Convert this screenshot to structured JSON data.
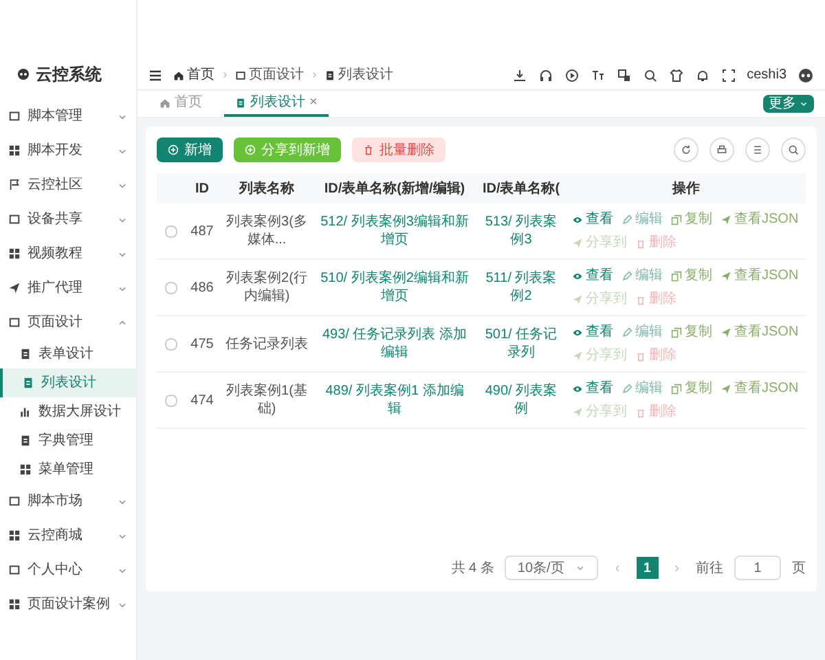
{
  "app": {
    "title": "云控系统"
  },
  "sidebar": {
    "items": [
      {
        "label": "脚本管理",
        "expanded": false
      },
      {
        "label": "脚本开发",
        "expanded": false
      },
      {
        "label": "云控社区",
        "expanded": false
      },
      {
        "label": "设备共享",
        "expanded": false
      },
      {
        "label": "视频教程",
        "expanded": false
      },
      {
        "label": "推广代理",
        "expanded": false
      },
      {
        "label": "页面设计",
        "expanded": true,
        "children": [
          {
            "label": "表单设计",
            "selected": false
          },
          {
            "label": "列表设计",
            "selected": true
          },
          {
            "label": "数据大屏设计",
            "selected": false
          },
          {
            "label": "字典管理",
            "selected": false
          },
          {
            "label": "菜单管理",
            "selected": false
          }
        ]
      },
      {
        "label": "脚本市场",
        "expanded": false
      },
      {
        "label": "云控商城",
        "expanded": false
      },
      {
        "label": "个人中心",
        "expanded": false
      },
      {
        "label": "页面设计案例",
        "expanded": false
      }
    ]
  },
  "breadcrumb": [
    "首页",
    "页面设计",
    "列表设计"
  ],
  "user": {
    "name": "ceshi3"
  },
  "tabs": [
    {
      "label": "首页",
      "selected": false
    },
    {
      "label": "列表设计",
      "selected": true,
      "close": "×"
    }
  ],
  "more_button": "更多",
  "toolbar": {
    "buttons": [
      {
        "label": "新增",
        "kind": "primary",
        "disabled": false
      },
      {
        "label": "分享到新增",
        "kind": "success",
        "disabled": false
      },
      {
        "label": "批量删除",
        "kind": "danger",
        "disabled": true
      }
    ]
  },
  "table": {
    "columns": [
      "ID",
      "列表名称",
      "ID/表单名称(新增/编辑)",
      "ID/表单名称(",
      "操作"
    ],
    "rows": [
      {
        "checked": false,
        "cells": [
          "487",
          "列表案例3(多媒体...",
          "512/ 列表案例3编辑和新增页",
          "513/ 列表案例3"
        ],
        "actions": [
          {
            "label": "查看",
            "kind": "view"
          },
          {
            "label": "编辑",
            "kind": "edit"
          },
          {
            "label": "复制",
            "kind": "copy"
          },
          {
            "label": "查看JSON",
            "kind": "json"
          },
          {
            "label": "分享到",
            "kind": "share"
          },
          {
            "label": "删除",
            "kind": "delete"
          }
        ]
      },
      {
        "checked": false,
        "cells": [
          "486",
          "列表案例2(行内编辑)",
          "510/ 列表案例2编辑和新增页",
          "511/ 列表案例2"
        ],
        "actions": [
          {
            "label": "查看",
            "kind": "view"
          },
          {
            "label": "编辑",
            "kind": "edit"
          },
          {
            "label": "复制",
            "kind": "copy"
          },
          {
            "label": "查看JSON",
            "kind": "json"
          },
          {
            "label": "分享到",
            "kind": "share"
          },
          {
            "label": "删除",
            "kind": "delete"
          }
        ]
      },
      {
        "checked": false,
        "cells": [
          "475",
          "任务记录列表",
          "493/ 任务记录列表 添加编辑",
          "501/ 任务记录列"
        ],
        "actions": [
          {
            "label": "查看",
            "kind": "view"
          },
          {
            "label": "编辑",
            "kind": "edit"
          },
          {
            "label": "复制",
            "kind": "copy"
          },
          {
            "label": "查看JSON",
            "kind": "json"
          },
          {
            "label": "分享到",
            "kind": "share"
          },
          {
            "label": "删除",
            "kind": "delete"
          }
        ]
      },
      {
        "checked": false,
        "cells": [
          "474",
          "列表案例1(基础)",
          "489/ 列表案例1 添加编辑",
          "490/ 列表案例"
        ],
        "actions": [
          {
            "label": "查看",
            "kind": "view"
          },
          {
            "label": "编辑",
            "kind": "edit"
          },
          {
            "label": "复制",
            "kind": "copy"
          },
          {
            "label": "查看JSON",
            "kind": "json"
          },
          {
            "label": "分享到",
            "kind": "share"
          },
          {
            "label": "删除",
            "kind": "delete"
          }
        ]
      }
    ]
  },
  "pagination": {
    "total": "共 4 条",
    "page_size": "10条/页",
    "prev": "‹",
    "pages": [
      {
        "label": "1",
        "selected": true
      }
    ],
    "next": "›",
    "goto_label": "前往",
    "goto_value": "1",
    "goto_suffix": "页"
  }
}
